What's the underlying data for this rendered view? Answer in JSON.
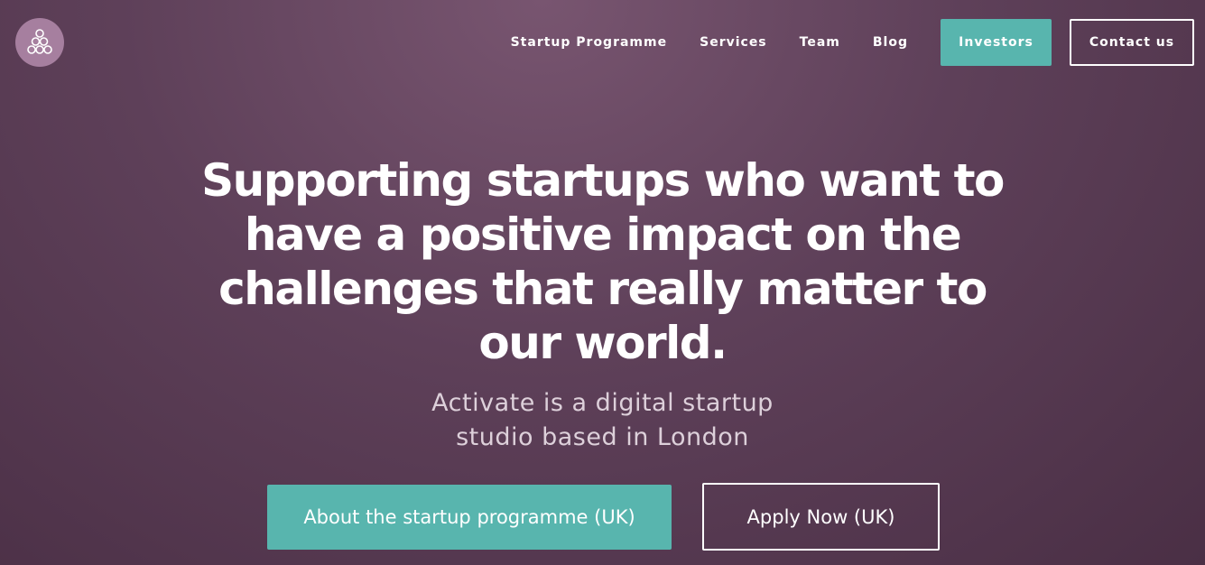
{
  "brand": {
    "logo_icon": "circles-logo-icon",
    "logo_bg": "#a67f9f"
  },
  "nav": {
    "links": [
      "Startup Programme",
      "Services",
      "Team",
      "Blog"
    ],
    "investors_label": "Investors",
    "contact_label": "Contact us"
  },
  "hero": {
    "title": "Supporting startups who want to have a positive impact on the challenges that really matter to our world.",
    "subtitle_line1": "Activate is a digital startup",
    "subtitle_line2": "studio based in London",
    "primary_cta": "About the startup programme (UK)",
    "secondary_cta": "Apply Now (UK)"
  },
  "colors": {
    "accent": "#58b5ae",
    "background_top": "#785570",
    "background_bottom": "#4a2f45"
  }
}
